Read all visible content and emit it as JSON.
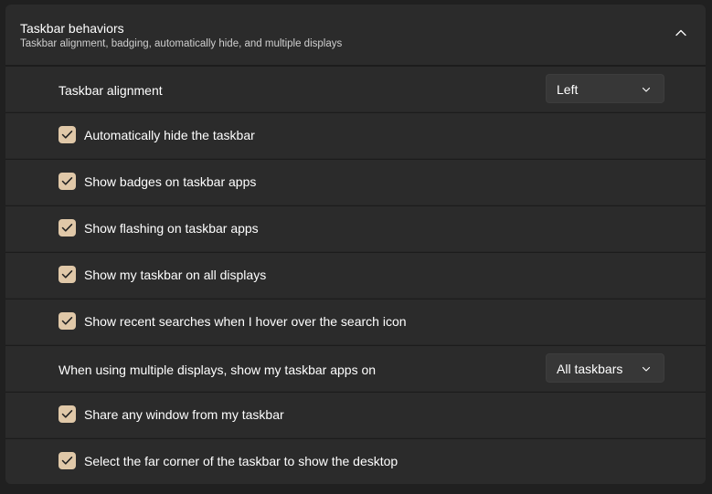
{
  "section": {
    "title": "Taskbar behaviors",
    "subtitle": "Taskbar alignment, badging, automatically hide, and multiple displays"
  },
  "settings": {
    "alignment": {
      "label": "Taskbar alignment",
      "value": "Left"
    },
    "auto_hide": {
      "label": "Automatically hide the taskbar",
      "checked": true
    },
    "badges": {
      "label": "Show badges on taskbar apps",
      "checked": true
    },
    "flashing": {
      "label": "Show flashing on taskbar apps",
      "checked": true
    },
    "all_displays": {
      "label": "Show my taskbar on all displays",
      "checked": true
    },
    "recent_searches": {
      "label": "Show recent searches when I hover over the search icon",
      "checked": true
    },
    "multi_display": {
      "label": "When using multiple displays, show my taskbar apps on",
      "value": "All taskbars"
    },
    "share_window": {
      "label": "Share any window from my taskbar",
      "checked": true
    },
    "far_corner": {
      "label": "Select the far corner of the taskbar to show the desktop",
      "checked": true
    }
  },
  "colors": {
    "accent": "#e0c8a8",
    "background": "#202020",
    "card": "#2b2b2b"
  }
}
